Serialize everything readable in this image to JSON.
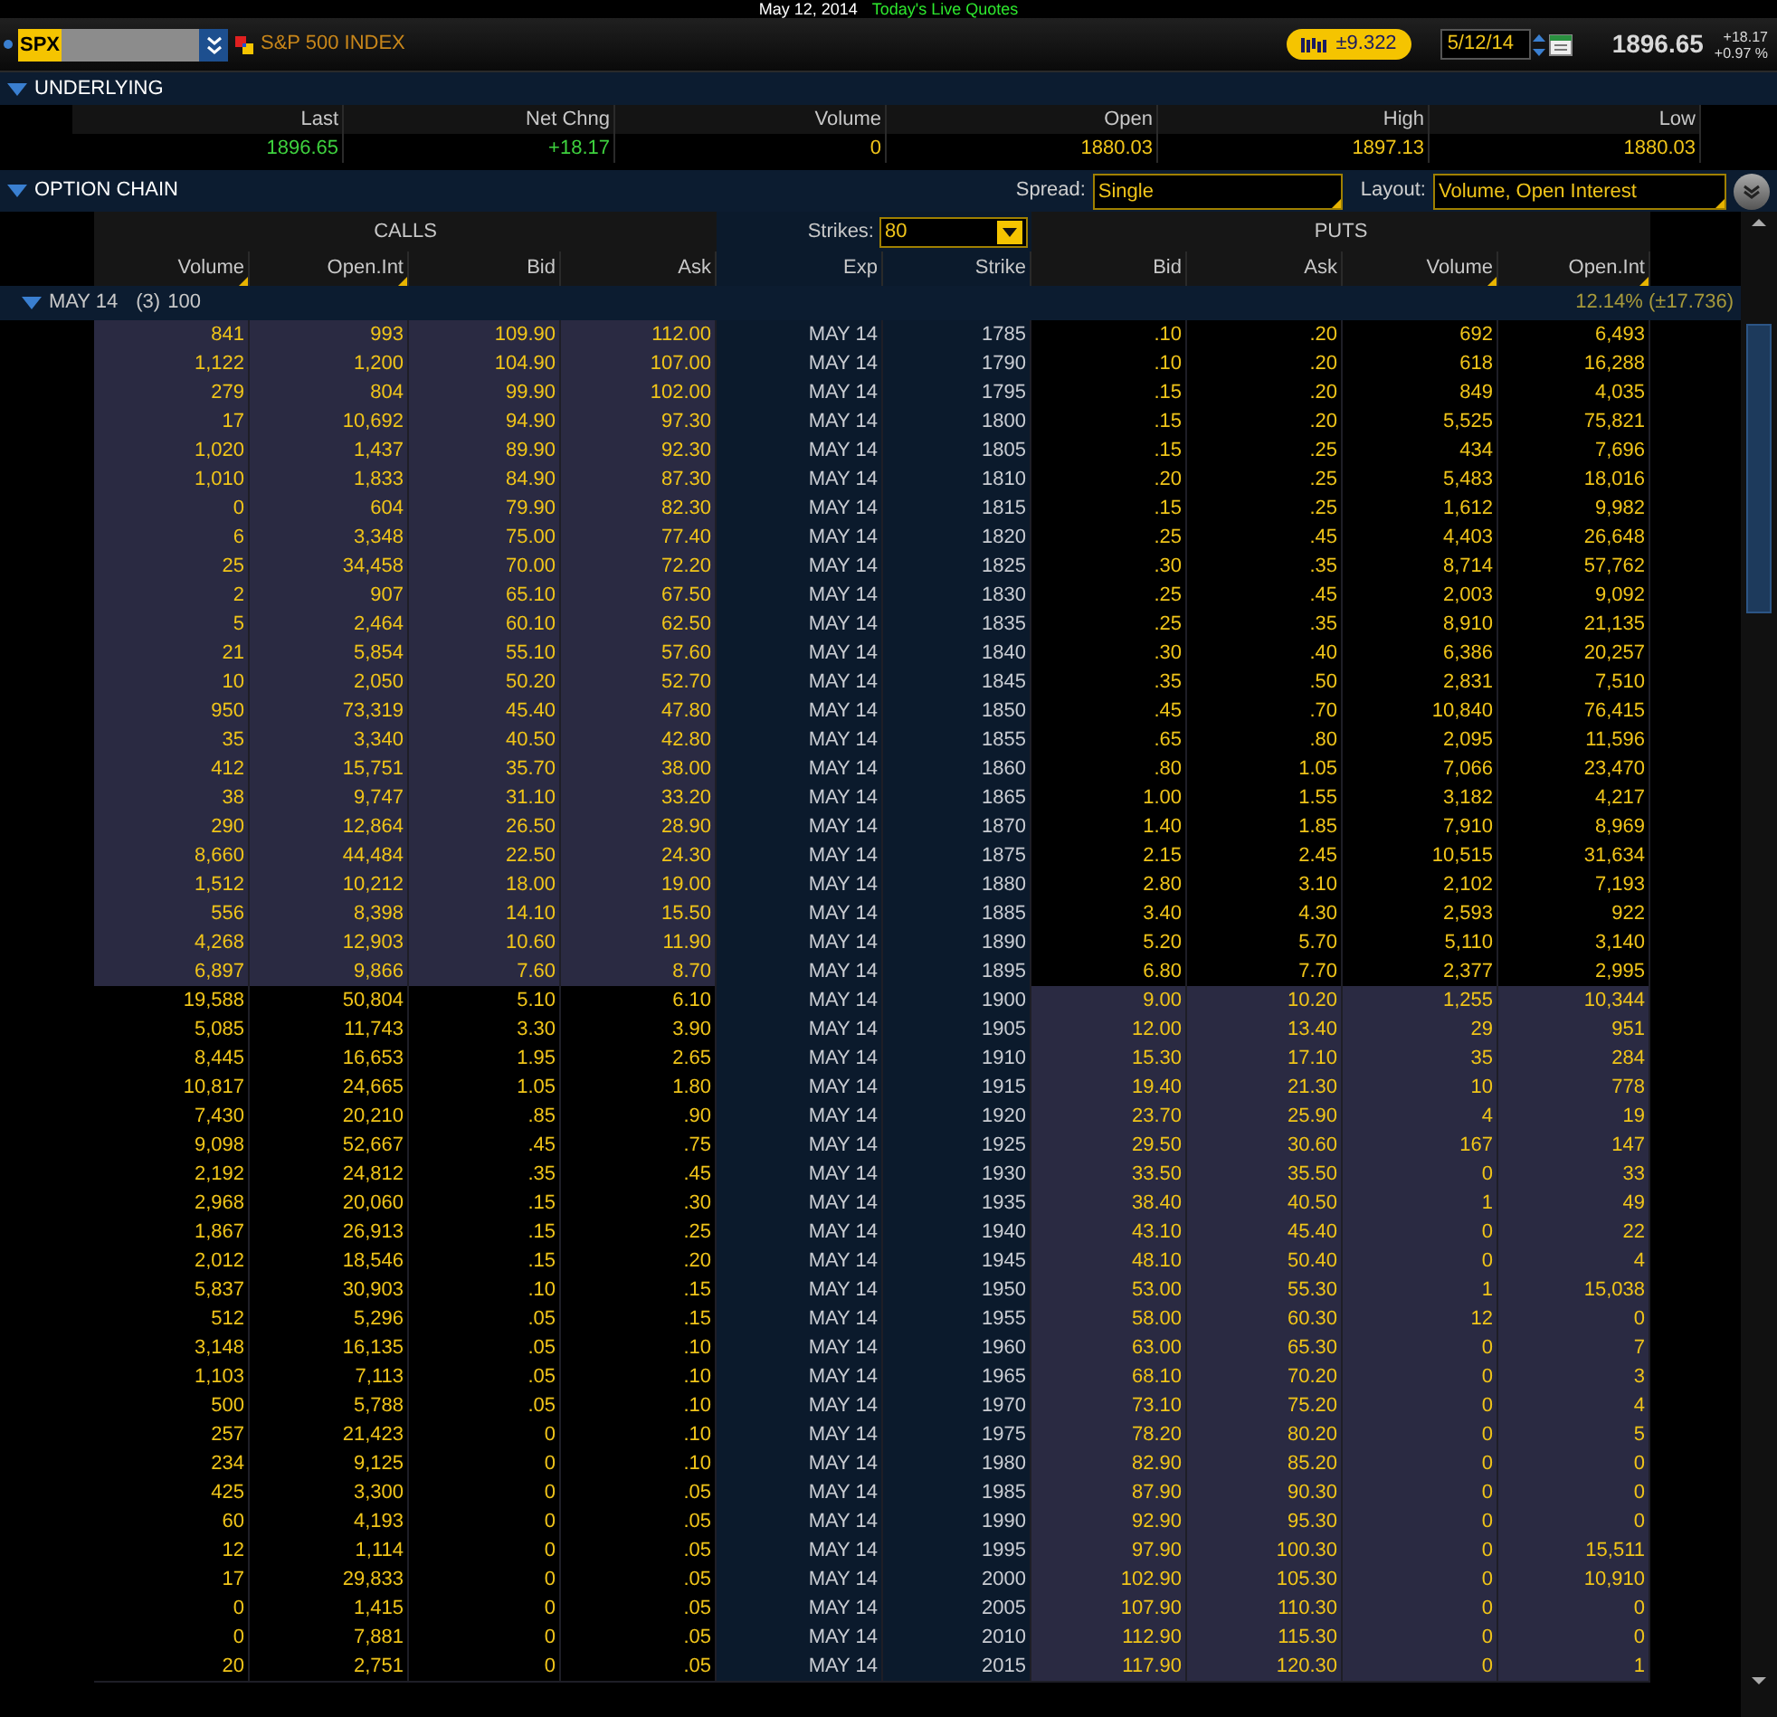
{
  "title_bar": {
    "date": "May 12, 2014",
    "live": "Today's Live Quotes"
  },
  "toolbar": {
    "symbol": "SPX",
    "description": "S&P 500 INDEX",
    "impl_move": "±9.322",
    "date": "5/12/14",
    "last": "1896.65",
    "change": "+18.17",
    "change_pct": "+0.97 %"
  },
  "underlying": {
    "title": "UNDERLYING",
    "expanded": true,
    "columns": [
      {
        "label": "Last",
        "value": "1896.65",
        "kind": "up"
      },
      {
        "label": "Net Chng",
        "value": "+18.17",
        "kind": "up"
      },
      {
        "label": "Volume",
        "value": "0",
        "kind": "plain"
      },
      {
        "label": "Open",
        "value": "1880.03",
        "kind": "plain"
      },
      {
        "label": "High",
        "value": "1897.13",
        "kind": "plain"
      },
      {
        "label": "Low",
        "value": "1880.03",
        "kind": "plain"
      }
    ]
  },
  "option_chain": {
    "title": "OPTION CHAIN",
    "expanded": true,
    "spread_label": "Spread:",
    "spread": "Single",
    "layout_label": "Layout:",
    "layout": "Volume, Open Interest",
    "calls_label": "CALLS",
    "puts_label": "PUTS",
    "strikes_label": "Strikes:",
    "strikes": "80",
    "columns": [
      {
        "label": "Volume",
        "sortable": true
      },
      {
        "label": "Open.Int",
        "sortable": true
      },
      {
        "label": "Bid",
        "sortable": false
      },
      {
        "label": "Ask",
        "sortable": false
      },
      {
        "label": "Exp",
        "sortable": false
      },
      {
        "label": "Strike",
        "sortable": false
      },
      {
        "label": "Bid",
        "sortable": false
      },
      {
        "label": "Ask",
        "sortable": false
      },
      {
        "label": "Volume",
        "sortable": true
      },
      {
        "label": "Open.Int",
        "sortable": true
      }
    ],
    "group": {
      "expanded": true,
      "label": "MAY 14",
      "count": "(3)",
      "multiplier": "100",
      "iv": "12.14% (±17.736)"
    },
    "rows": [
      {
        "calls_itm": true,
        "cells": [
          "841",
          "993",
          "109.90",
          "112.00",
          "MAY 14",
          "1785",
          ".10",
          ".20",
          "692",
          "6,493"
        ]
      },
      {
        "calls_itm": true,
        "cells": [
          "1,122",
          "1,200",
          "104.90",
          "107.00",
          "MAY 14",
          "1790",
          ".10",
          ".20",
          "618",
          "16,288"
        ]
      },
      {
        "calls_itm": true,
        "cells": [
          "279",
          "804",
          "99.90",
          "102.00",
          "MAY 14",
          "1795",
          ".15",
          ".20",
          "849",
          "4,035"
        ]
      },
      {
        "calls_itm": true,
        "cells": [
          "17",
          "10,692",
          "94.90",
          "97.30",
          "MAY 14",
          "1800",
          ".15",
          ".20",
          "5,525",
          "75,821"
        ]
      },
      {
        "calls_itm": true,
        "cells": [
          "1,020",
          "1,437",
          "89.90",
          "92.30",
          "MAY 14",
          "1805",
          ".15",
          ".25",
          "434",
          "7,696"
        ]
      },
      {
        "calls_itm": true,
        "cells": [
          "1,010",
          "1,833",
          "84.90",
          "87.30",
          "MAY 14",
          "1810",
          ".20",
          ".25",
          "5,483",
          "18,016"
        ]
      },
      {
        "calls_itm": true,
        "cells": [
          "0",
          "604",
          "79.90",
          "82.30",
          "MAY 14",
          "1815",
          ".15",
          ".25",
          "1,612",
          "9,982"
        ]
      },
      {
        "calls_itm": true,
        "cells": [
          "6",
          "3,348",
          "75.00",
          "77.40",
          "MAY 14",
          "1820",
          ".25",
          ".45",
          "4,403",
          "26,648"
        ]
      },
      {
        "calls_itm": true,
        "cells": [
          "25",
          "34,458",
          "70.00",
          "72.20",
          "MAY 14",
          "1825",
          ".30",
          ".35",
          "8,714",
          "57,762"
        ]
      },
      {
        "calls_itm": true,
        "cells": [
          "2",
          "907",
          "65.10",
          "67.50",
          "MAY 14",
          "1830",
          ".25",
          ".45",
          "2,003",
          "9,092"
        ]
      },
      {
        "calls_itm": true,
        "cells": [
          "5",
          "2,464",
          "60.10",
          "62.50",
          "MAY 14",
          "1835",
          ".25",
          ".35",
          "8,910",
          "21,135"
        ]
      },
      {
        "calls_itm": true,
        "cells": [
          "21",
          "5,854",
          "55.10",
          "57.60",
          "MAY 14",
          "1840",
          ".30",
          ".40",
          "6,386",
          "20,257"
        ]
      },
      {
        "calls_itm": true,
        "cells": [
          "10",
          "2,050",
          "50.20",
          "52.70",
          "MAY 14",
          "1845",
          ".35",
          ".50",
          "2,831",
          "7,510"
        ]
      },
      {
        "calls_itm": true,
        "cells": [
          "950",
          "73,319",
          "45.40",
          "47.80",
          "MAY 14",
          "1850",
          ".45",
          ".70",
          "10,840",
          "76,415"
        ]
      },
      {
        "calls_itm": true,
        "cells": [
          "35",
          "3,340",
          "40.50",
          "42.80",
          "MAY 14",
          "1855",
          ".65",
          ".80",
          "2,095",
          "11,596"
        ]
      },
      {
        "calls_itm": true,
        "cells": [
          "412",
          "15,751",
          "35.70",
          "38.00",
          "MAY 14",
          "1860",
          ".80",
          "1.05",
          "7,066",
          "23,470"
        ]
      },
      {
        "calls_itm": true,
        "cells": [
          "38",
          "9,747",
          "31.10",
          "33.20",
          "MAY 14",
          "1865",
          "1.00",
          "1.55",
          "3,182",
          "4,217"
        ]
      },
      {
        "calls_itm": true,
        "cells": [
          "290",
          "12,864",
          "26.50",
          "28.90",
          "MAY 14",
          "1870",
          "1.40",
          "1.85",
          "7,910",
          "8,969"
        ]
      },
      {
        "calls_itm": true,
        "cells": [
          "8,660",
          "44,484",
          "22.50",
          "24.30",
          "MAY 14",
          "1875",
          "2.15",
          "2.45",
          "10,515",
          "31,634"
        ]
      },
      {
        "calls_itm": true,
        "cells": [
          "1,512",
          "10,212",
          "18.00",
          "19.00",
          "MAY 14",
          "1880",
          "2.80",
          "3.10",
          "2,102",
          "7,193"
        ]
      },
      {
        "calls_itm": true,
        "cells": [
          "556",
          "8,398",
          "14.10",
          "15.50",
          "MAY 14",
          "1885",
          "3.40",
          "4.30",
          "2,593",
          "922"
        ]
      },
      {
        "calls_itm": true,
        "cells": [
          "4,268",
          "12,903",
          "10.60",
          "11.90",
          "MAY 14",
          "1890",
          "5.20",
          "5.70",
          "5,110",
          "3,140"
        ]
      },
      {
        "calls_itm": true,
        "cells": [
          "6,897",
          "9,866",
          "7.60",
          "8.70",
          "MAY 14",
          "1895",
          "6.80",
          "7.70",
          "2,377",
          "2,995"
        ]
      },
      {
        "calls_itm": false,
        "cells": [
          "19,588",
          "50,804",
          "5.10",
          "6.10",
          "MAY 14",
          "1900",
          "9.00",
          "10.20",
          "1,255",
          "10,344"
        ]
      },
      {
        "calls_itm": false,
        "cells": [
          "5,085",
          "11,743",
          "3.30",
          "3.90",
          "MAY 14",
          "1905",
          "12.00",
          "13.40",
          "29",
          "951"
        ]
      },
      {
        "calls_itm": false,
        "cells": [
          "8,445",
          "16,653",
          "1.95",
          "2.65",
          "MAY 14",
          "1910",
          "15.30",
          "17.10",
          "35",
          "284"
        ]
      },
      {
        "calls_itm": false,
        "cells": [
          "10,817",
          "24,665",
          "1.05",
          "1.80",
          "MAY 14",
          "1915",
          "19.40",
          "21.30",
          "10",
          "778"
        ]
      },
      {
        "calls_itm": false,
        "cells": [
          "7,430",
          "20,210",
          ".85",
          ".90",
          "MAY 14",
          "1920",
          "23.70",
          "25.90",
          "4",
          "19"
        ]
      },
      {
        "calls_itm": false,
        "cells": [
          "9,098",
          "52,667",
          ".45",
          ".75",
          "MAY 14",
          "1925",
          "29.50",
          "30.60",
          "167",
          "147"
        ]
      },
      {
        "calls_itm": false,
        "cells": [
          "2,192",
          "24,812",
          ".35",
          ".45",
          "MAY 14",
          "1930",
          "33.50",
          "35.50",
          "0",
          "33"
        ]
      },
      {
        "calls_itm": false,
        "cells": [
          "2,968",
          "20,060",
          ".15",
          ".30",
          "MAY 14",
          "1935",
          "38.40",
          "40.50",
          "1",
          "49"
        ]
      },
      {
        "calls_itm": false,
        "cells": [
          "1,867",
          "26,913",
          ".15",
          ".25",
          "MAY 14",
          "1940",
          "43.10",
          "45.40",
          "0",
          "22"
        ]
      },
      {
        "calls_itm": false,
        "cells": [
          "2,012",
          "18,546",
          ".15",
          ".20",
          "MAY 14",
          "1945",
          "48.10",
          "50.40",
          "0",
          "4"
        ]
      },
      {
        "calls_itm": false,
        "cells": [
          "5,837",
          "30,903",
          ".10",
          ".15",
          "MAY 14",
          "1950",
          "53.00",
          "55.30",
          "1",
          "15,038"
        ]
      },
      {
        "calls_itm": false,
        "cells": [
          "512",
          "5,296",
          ".05",
          ".15",
          "MAY 14",
          "1955",
          "58.00",
          "60.30",
          "12",
          "0"
        ]
      },
      {
        "calls_itm": false,
        "cells": [
          "3,148",
          "16,135",
          ".05",
          ".10",
          "MAY 14",
          "1960",
          "63.00",
          "65.30",
          "0",
          "7"
        ]
      },
      {
        "calls_itm": false,
        "cells": [
          "1,103",
          "7,113",
          ".05",
          ".10",
          "MAY 14",
          "1965",
          "68.10",
          "70.20",
          "0",
          "3"
        ]
      },
      {
        "calls_itm": false,
        "cells": [
          "500",
          "5,788",
          ".05",
          ".10",
          "MAY 14",
          "1970",
          "73.10",
          "75.20",
          "0",
          "4"
        ]
      },
      {
        "calls_itm": false,
        "cells": [
          "257",
          "21,423",
          "0",
          ".10",
          "MAY 14",
          "1975",
          "78.20",
          "80.20",
          "0",
          "5"
        ]
      },
      {
        "calls_itm": false,
        "cells": [
          "234",
          "9,125",
          "0",
          ".10",
          "MAY 14",
          "1980",
          "82.90",
          "85.20",
          "0",
          "0"
        ]
      },
      {
        "calls_itm": false,
        "cells": [
          "425",
          "3,300",
          "0",
          ".05",
          "MAY 14",
          "1985",
          "87.90",
          "90.30",
          "0",
          "0"
        ]
      },
      {
        "calls_itm": false,
        "cells": [
          "60",
          "4,193",
          "0",
          ".05",
          "MAY 14",
          "1990",
          "92.90",
          "95.30",
          "0",
          "0"
        ]
      },
      {
        "calls_itm": false,
        "cells": [
          "12",
          "1,114",
          "0",
          ".05",
          "MAY 14",
          "1995",
          "97.90",
          "100.30",
          "0",
          "15,511"
        ]
      },
      {
        "calls_itm": false,
        "cells": [
          "17",
          "29,833",
          "0",
          ".05",
          "MAY 14",
          "2000",
          "102.90",
          "105.30",
          "0",
          "10,910"
        ]
      },
      {
        "calls_itm": false,
        "cells": [
          "0",
          "1,415",
          "0",
          ".05",
          "MAY 14",
          "2005",
          "107.90",
          "110.30",
          "0",
          "0"
        ]
      },
      {
        "calls_itm": false,
        "cells": [
          "0",
          "7,881",
          "0",
          ".05",
          "MAY 14",
          "2010",
          "112.90",
          "115.30",
          "0",
          "0"
        ]
      },
      {
        "calls_itm": false,
        "cells": [
          "20",
          "2,751",
          "0",
          ".05",
          "MAY 14",
          "2015",
          "117.90",
          "120.30",
          "0",
          "1"
        ]
      }
    ]
  }
}
